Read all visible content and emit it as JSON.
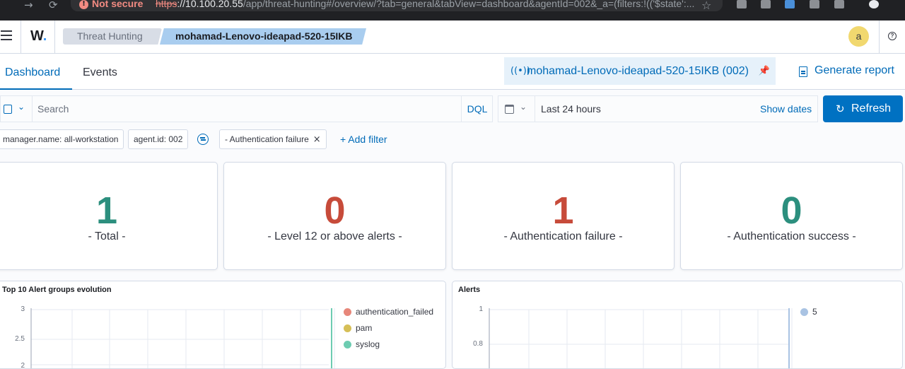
{
  "browser": {
    "not_secure": "Not secure",
    "url_scheme": "https",
    "url_host": "://10.100.20.55",
    "url_path": "/app/threat-hunting#/overview/?tab=general&tabView=dashboard&agentId=002&_a=(filters:!(('$state':..."
  },
  "header": {
    "logo": "W",
    "breadcrumbs": [
      "Threat Hunting",
      "mohamad-Lenovo-ideapad-520-15IKB"
    ],
    "avatar_initial": "a"
  },
  "tabs": [
    {
      "label": "Dashboard",
      "active": true
    },
    {
      "label": "Events",
      "active": false
    }
  ],
  "agent": {
    "label": "mohamad-Lenovo-ideapad-520-15IKB (002)"
  },
  "generate_report": "Generate report",
  "search": {
    "placeholder": "Search",
    "language": "DQL"
  },
  "date": {
    "range": "Last 24 hours",
    "show_dates": "Show dates"
  },
  "refresh_label": "Refresh",
  "filters": [
    {
      "label": "manager.name: all-workstation"
    },
    {
      "label": "agent.id: 002"
    },
    {
      "label": "- Authentication failure"
    }
  ],
  "add_filter": "+ Add filter",
  "metrics": [
    {
      "value": "1",
      "label": "- Total -",
      "color": "#2c8f7e"
    },
    {
      "value": "0",
      "label": "- Level 12 or above alerts -",
      "color": "#c74b3a"
    },
    {
      "value": "1",
      "label": "- Authentication failure -",
      "color": "#c74b3a"
    },
    {
      "value": "0",
      "label": "- Authentication success -",
      "color": "#2c8f7e"
    }
  ],
  "panels": {
    "alert_groups": {
      "title": "Top 10 Alert groups evolution",
      "y_ticks": [
        "3",
        "2.5",
        "2"
      ],
      "legend": [
        {
          "name": "authentication_failed",
          "color": "#e7877a"
        },
        {
          "name": "pam",
          "color": "#d6bf57"
        },
        {
          "name": "syslog",
          "color": "#6dccb1"
        }
      ]
    },
    "alerts": {
      "title": "Alerts",
      "y_ticks": [
        "1",
        "0.8"
      ],
      "legend": [
        {
          "name": "5",
          "color": "#a9c3e3"
        }
      ]
    }
  }
}
